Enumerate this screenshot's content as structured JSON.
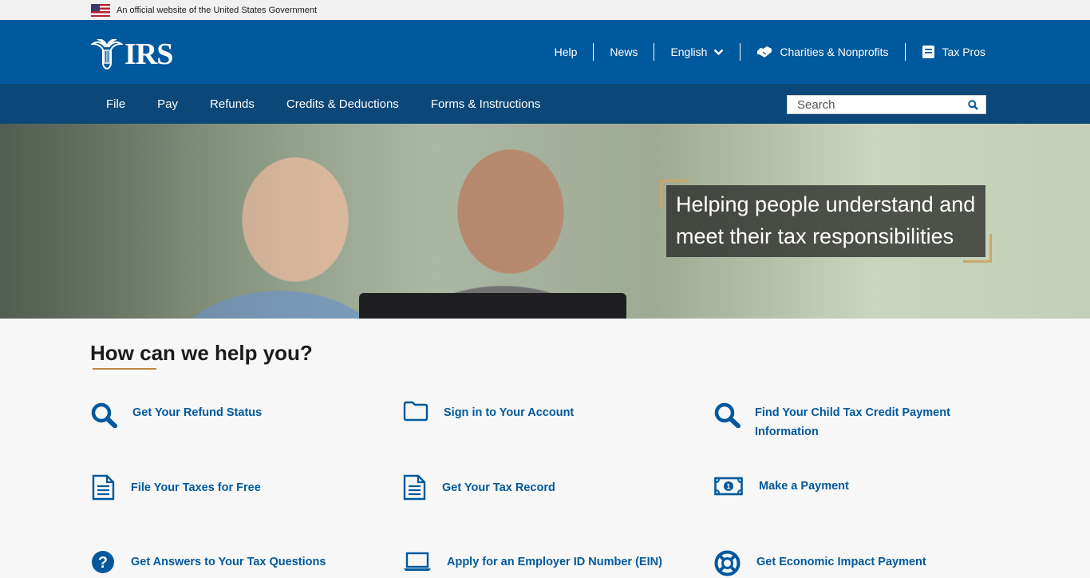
{
  "gov_banner": {
    "text": "An official website of the United States Government"
  },
  "header": {
    "logo_text": "IRS",
    "links": [
      {
        "label": "Help"
      },
      {
        "label": "News"
      },
      {
        "label": "English"
      },
      {
        "label": "Charities & Nonprofits"
      },
      {
        "label": "Tax Pros"
      }
    ]
  },
  "nav": {
    "items": [
      {
        "label": "File"
      },
      {
        "label": "Pay"
      },
      {
        "label": "Refunds"
      },
      {
        "label": "Credits & Deductions"
      },
      {
        "label": "Forms & Instructions"
      }
    ],
    "search_placeholder": "Search"
  },
  "hero": {
    "caption": "Helping people understand and meet their tax responsibilities"
  },
  "help": {
    "title": "How can we help you?",
    "tiles": [
      {
        "label": "Get Your Refund Status",
        "icon": "search-icon"
      },
      {
        "label": "Sign in to Your Account",
        "icon": "folder-icon"
      },
      {
        "label": "Find Your Child Tax Credit Payment Information",
        "icon": "search-icon"
      },
      {
        "label": "File Your Taxes for Free",
        "icon": "document-icon"
      },
      {
        "label": "Get Your Tax Record",
        "icon": "document-icon"
      },
      {
        "label": "Make a Payment",
        "icon": "money-icon"
      },
      {
        "label": "Get Answers to Your Tax Questions",
        "icon": "question-icon"
      },
      {
        "label": "Apply for an Employer ID Number (EIN)",
        "icon": "laptop-icon"
      },
      {
        "label": "Get Economic Impact Payment",
        "icon": "lifebuoy-icon"
      }
    ]
  },
  "colors": {
    "header_blue": "#00599c",
    "nav_blue": "#0b4778",
    "accent_gold": "#c9a86a",
    "link_blue": "#00599c"
  }
}
